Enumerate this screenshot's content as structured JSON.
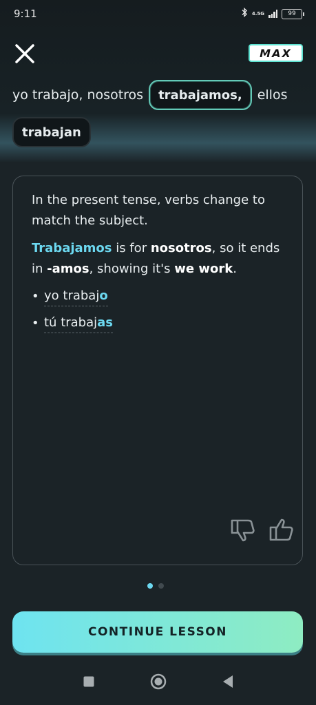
{
  "status_bar": {
    "time": "9:11",
    "network": "4.5G",
    "battery": "99"
  },
  "header": {
    "close_icon": "close-icon",
    "badge": "MAX"
  },
  "sentence": {
    "prefix": "yo trabajo, nosotros",
    "chips": [
      "trabajamos,",
      "trabajan"
    ],
    "middle": "ellos"
  },
  "explanation": {
    "para1": "In the present tense, verbs change to match the subject.",
    "para2_word": "Trabajamos",
    "para2_a": " is for ",
    "para2_subject": "nosotros",
    "para2_b": ", so it ends in ",
    "para2_ending": "-amos",
    "para2_c": ", showing it's ",
    "para2_meaning": "we work",
    "para2_d": ".",
    "bullets": [
      {
        "stem": "yo trabaj",
        "ending": "o"
      },
      {
        "stem": "tú trabaj",
        "ending": "as"
      }
    ]
  },
  "feedback": {
    "dislike_icon": "thumbs-down-icon",
    "like_icon": "thumbs-up-icon"
  },
  "pagination": {
    "current": 1,
    "total": 2
  },
  "continue_button": "CONTINUE LESSON",
  "colors": {
    "accent": "#6cd8f0",
    "chip_border": "#64c9b7",
    "background": "#1b2327"
  }
}
